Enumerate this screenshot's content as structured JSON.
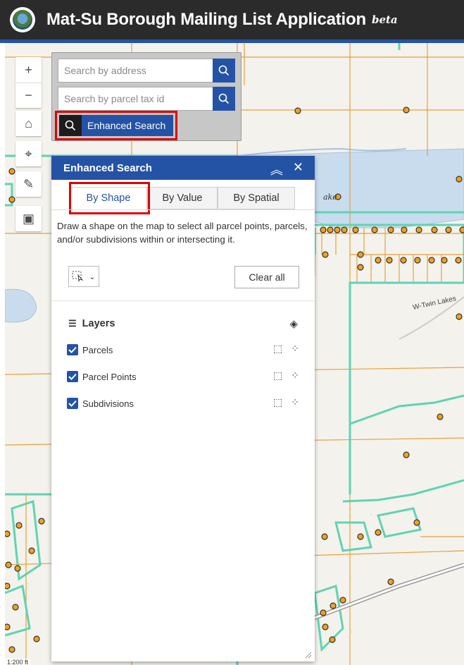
{
  "header": {
    "title": "Mat-Su Borough Mailing List Application",
    "beta": "beta"
  },
  "colors": {
    "header_bg": "#2b2b2b",
    "accent": "#2453a6",
    "highlight": "#e10000",
    "parcel_line": "#e7a13c",
    "subdivision_line": "#5fd3b5",
    "water": "#c8dced"
  },
  "map_tools": [
    {
      "icon": "zoom-in-icon",
      "glyph": "+"
    },
    {
      "icon": "zoom-out-icon",
      "glyph": "−"
    },
    {
      "icon": "home-icon",
      "glyph": "⌂"
    },
    {
      "icon": "locate-icon",
      "glyph": "⌖"
    },
    {
      "icon": "measure-icon",
      "glyph": "✎"
    },
    {
      "icon": "bookmark-icon",
      "glyph": "▣"
    }
  ],
  "search": {
    "address_placeholder": "Search by address",
    "parcel_placeholder": "Search by parcel tax id",
    "enhanced_label": "Enhanced Search"
  },
  "enhanced_panel": {
    "title": "Enhanced Search",
    "tabs": [
      "By Shape",
      "By Value",
      "By Spatial"
    ],
    "active_tab": "By Shape",
    "description": "Draw a shape on the map to select all parcel points, parcels, and/or subdivisions within or intersecting it.",
    "clear_all": "Clear all",
    "layers_title": "Layers",
    "layers": [
      {
        "label": "Parcels",
        "checked": true
      },
      {
        "label": "Parcel Points",
        "checked": true
      },
      {
        "label": "Subdivisions",
        "checked": true
      }
    ]
  },
  "map_labels": {
    "road": "W-Twin Lakes",
    "lake_fragment": "ake",
    "scale": "1:200 ft"
  }
}
